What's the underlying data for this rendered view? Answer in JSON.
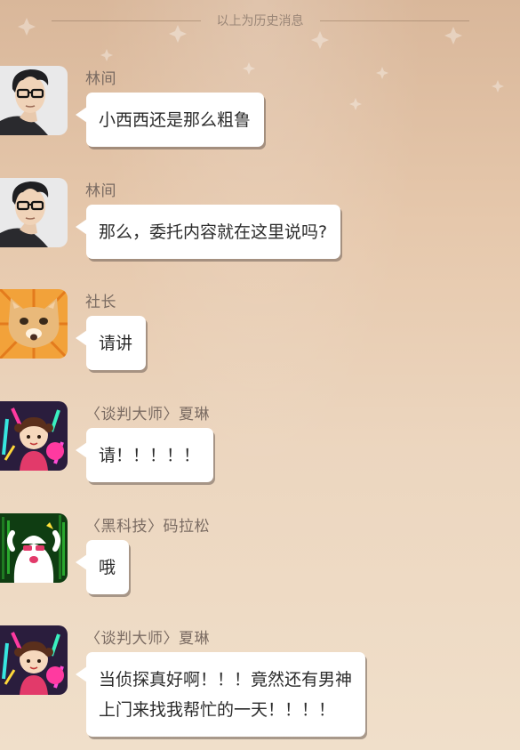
{
  "history_divider": {
    "text": "以上为历史消息"
  },
  "messages": [
    {
      "sender": "林间",
      "avatar": "young-man-glasses-avatar",
      "lines": [
        "小西西还是那么粗鲁"
      ]
    },
    {
      "sender": "林间",
      "avatar": "young-man-glasses-avatar",
      "lines": [
        "那么，委托内容就在这里说吗?"
      ]
    },
    {
      "sender": "社长",
      "avatar": "cat-avatar",
      "lines": [
        "请讲"
      ]
    },
    {
      "sender": "〈谈判大师〉夏琳",
      "avatar": "cartoon-girl-avatar",
      "lines": [
        "请！！！！！"
      ]
    },
    {
      "sender": "〈黑科技〉码拉松",
      "avatar": "cartoon-ghost-avatar",
      "lines": [
        "哦"
      ]
    },
    {
      "sender": "〈谈判大师〉夏琳",
      "avatar": "cartoon-girl-avatar",
      "lines": [
        "当侦探真好啊！！！竟然还有男神",
        "上门来找我帮忙的一天！！！！"
      ]
    }
  ],
  "colors": {
    "background_top": "#d9b79a",
    "background_bottom": "#f0dfca",
    "bubble": "#ffffff",
    "sender_name": "#7a6b62",
    "divider_text": "#9a8677"
  }
}
